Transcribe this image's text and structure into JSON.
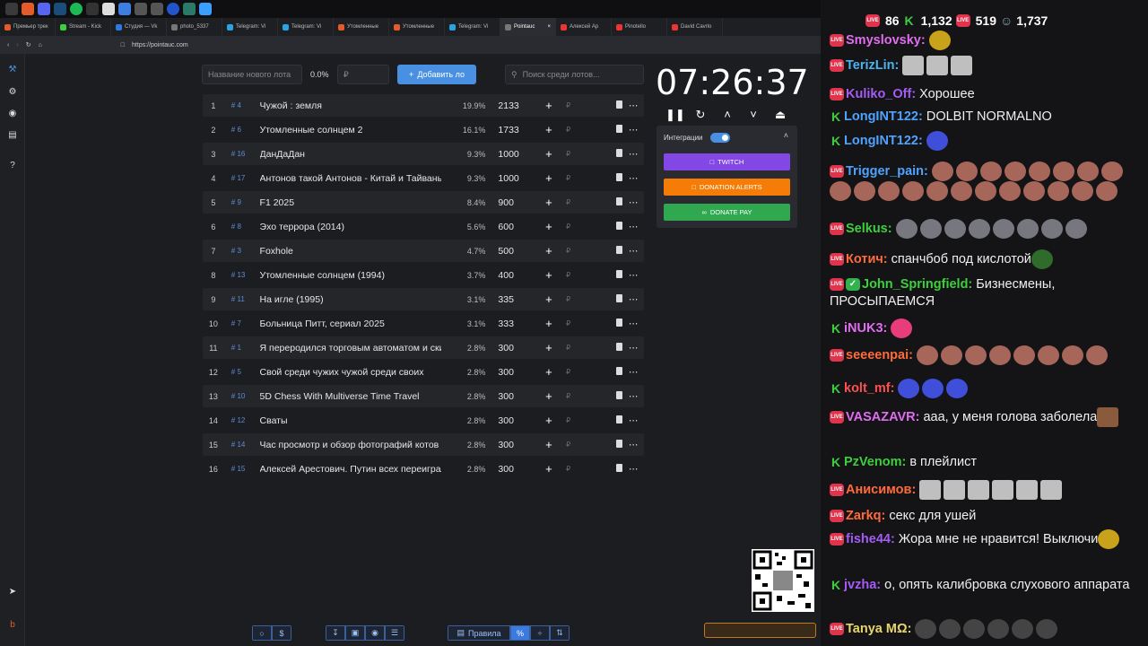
{
  "browser": {
    "tabs": [
      "Премьер трек",
      "Stream - Kick",
      "Студия — Vk",
      "photo_5337",
      "Telegram: Vi",
      "Telegram: Vi",
      "Утомленные",
      "Утомленные",
      "Telegram: Vi",
      "Pointauc",
      "Алексей Ар",
      "Pinotello",
      "David Cavrlo"
    ],
    "url": "https://pointauc.com"
  },
  "auction": {
    "new_lot_placeholder": "Название нового лота",
    "percent": "0.0%",
    "amount_placeholder": "₽",
    "add_button": "Добавить ло",
    "search_placeholder": "Поиск среди лотов...",
    "lots": [
      {
        "n": "1",
        "id": "# 4",
        "name": "Чужой : земля",
        "pct": "19.9%",
        "amount": "2133"
      },
      {
        "n": "2",
        "id": "# 6",
        "name": "Утомленные солнцем 2",
        "pct": "16.1%",
        "amount": "1733"
      },
      {
        "n": "3",
        "id": "# 16",
        "name": "ДанДаДан",
        "pct": "9.3%",
        "amount": "1000"
      },
      {
        "n": "4",
        "id": "# 17",
        "name": "Антонов такой Антонов - Китай и Тайвань",
        "pct": "9.3%",
        "amount": "1000"
      },
      {
        "n": "5",
        "id": "# 9",
        "name": "F1 2025",
        "pct": "8.4%",
        "amount": "900"
      },
      {
        "n": "6",
        "id": "# 8",
        "name": "Эхо террора (2014)",
        "pct": "5.6%",
        "amount": "600"
      },
      {
        "n": "7",
        "id": "# 3",
        "name": "Foxhole",
        "pct": "4.7%",
        "amount": "500"
      },
      {
        "n": "8",
        "id": "# 13",
        "name": "Утомленные солнцем (1994)",
        "pct": "3.7%",
        "amount": "400"
      },
      {
        "n": "9",
        "id": "# 11",
        "name": "На игле (1995)",
        "pct": "3.1%",
        "amount": "335"
      },
      {
        "n": "10",
        "id": "# 7",
        "name": "Больница Питт, сериал 2025",
        "pct": "3.1%",
        "amount": "333"
      },
      {
        "n": "11",
        "id": "# 1",
        "name": "Я переродился торговым автоматом и скитаюсь",
        "pct": "2.8%",
        "amount": "300"
      },
      {
        "n": "12",
        "id": "# 5",
        "name": "Свой среди чужих чужой среди своих",
        "pct": "2.8%",
        "amount": "300"
      },
      {
        "n": "13",
        "id": "# 10",
        "name": "5D Chess With Multiverse Time Travel",
        "pct": "2.8%",
        "amount": "300"
      },
      {
        "n": "14",
        "id": "# 12",
        "name": "Сваты",
        "pct": "2.8%",
        "amount": "300"
      },
      {
        "n": "15",
        "id": "# 14",
        "name": "Час просмотр и обзор фотографий котов",
        "pct": "2.8%",
        "amount": "300"
      },
      {
        "n": "16",
        "id": "# 15",
        "name": "Алексей Арестович. Путин всех переиграл",
        "pct": "2.8%",
        "amount": "300"
      }
    ]
  },
  "timer": {
    "value": "07:26:37"
  },
  "integrations": {
    "title": "Интеграции",
    "twitch": "TWITCH",
    "donation_alerts": "DONATION ALERTS",
    "donate_pay": "DONATE PAY"
  },
  "footer": {
    "rules": "Правила"
  },
  "chat": {
    "stats": {
      "viewers_a": "86",
      "viewers_k": "1,132",
      "viewers_v": "519",
      "total": "1,737"
    },
    "messages": [
      {
        "user": "Smyslovsky",
        "color": "#e06df0",
        "badge": "live",
        "text": "",
        "emotes": [
          "em-y"
        ]
      },
      {
        "user": "TerizLin",
        "color": "#4db3f0",
        "badge": "live",
        "text": "",
        "emotes": [
          "em-g",
          "em-g",
          "em-g"
        ]
      },
      {
        "user": "Kuliko_Off",
        "color": "#a45cf5",
        "badge": "live",
        "text": "Хорошее",
        "emotes": []
      },
      {
        "user": "LongINT122",
        "color": "#4fa3ff",
        "badge": "k",
        "text": "DOLBIT NORMALNO",
        "emotes": []
      },
      {
        "user": "LongINT122",
        "color": "#4fa3ff",
        "badge": "k",
        "text": "",
        "emotes": [
          "em-b"
        ]
      },
      {
        "user": "Trigger_pain",
        "color": "#4fa3ff",
        "badge": "live",
        "text": "",
        "emotes": [
          "em-r",
          "em-r",
          "em-r",
          "em-r",
          "em-r",
          "em-r",
          "em-r",
          "em-r",
          "em-r",
          "em-r",
          "em-r",
          "em-r",
          "em-r",
          "em-r",
          "em-r",
          "em-r",
          "em-r",
          "em-r",
          "em-r",
          "em-r"
        ]
      },
      {
        "user": "Selkus",
        "color": "#3ecf3e",
        "badge": "live",
        "text": "",
        "emotes": [
          "em-rac",
          "em-rac",
          "em-rac",
          "em-rac",
          "em-rac",
          "em-rac",
          "em-rac",
          "em-rac"
        ]
      },
      {
        "user": "Котич",
        "color": "#ff6b3d",
        "badge": "live",
        "text": "спанчбоб под кислотой",
        "emotes": [
          "em-gr"
        ]
      },
      {
        "user": "John_Springfield",
        "color": "#3ecf3e",
        "badge": "live-ok",
        "text": "Бизнесмены, ПРОСЫПАЕМСЯ",
        "emotes": []
      },
      {
        "user": "iNUK3",
        "color": "#e06df0",
        "badge": "k",
        "text": "",
        "emotes": [
          "em-pk"
        ]
      },
      {
        "user": "seeeenpai",
        "color": "#ff6b3d",
        "badge": "live",
        "text": "",
        "emotes": [
          "em-r",
          "em-r",
          "em-r",
          "em-r",
          "em-r",
          "em-r",
          "em-r",
          "em-r"
        ]
      },
      {
        "user": "kolt_mf",
        "color": "#ff5050",
        "badge": "k",
        "text": "",
        "emotes": [
          "em-b",
          "em-b",
          "em-b"
        ]
      },
      {
        "user": "VASAZAVR",
        "color": "#e06df0",
        "badge": "live",
        "text": "ааа, у меня голова заболела",
        "emotes": [
          "em-face"
        ]
      },
      {
        "user": "PzVenom",
        "color": "#3ecf3e",
        "badge": "k",
        "text": "в плейлист",
        "emotes": []
      },
      {
        "user": "Анисимов",
        "color": "#ff6b3d",
        "badge": "live",
        "text": "",
        "emotes": [
          "em-g",
          "em-g",
          "em-g",
          "em-g",
          "em-g",
          "em-g"
        ]
      },
      {
        "user": "Zarkq",
        "color": "#ff6b3d",
        "badge": "live",
        "text": "секс для ушей",
        "emotes": []
      },
      {
        "user": "fishe44",
        "color": "#a45cf5",
        "badge": "live",
        "text": "Жора мне не нравится! Выключи",
        "emotes": [
          "em-y"
        ]
      },
      {
        "user": "jvzha",
        "color": "#a45cf5",
        "badge": "k",
        "text": "о, опять калибровка слухового аппарата",
        "emotes": []
      },
      {
        "user": "Tanya MΩ",
        "color": "#e8d66b",
        "badge": "live",
        "text": "",
        "emotes": [
          "em-d",
          "em-d",
          "em-d",
          "em-d",
          "em-d",
          "em-d"
        ]
      }
    ]
  }
}
